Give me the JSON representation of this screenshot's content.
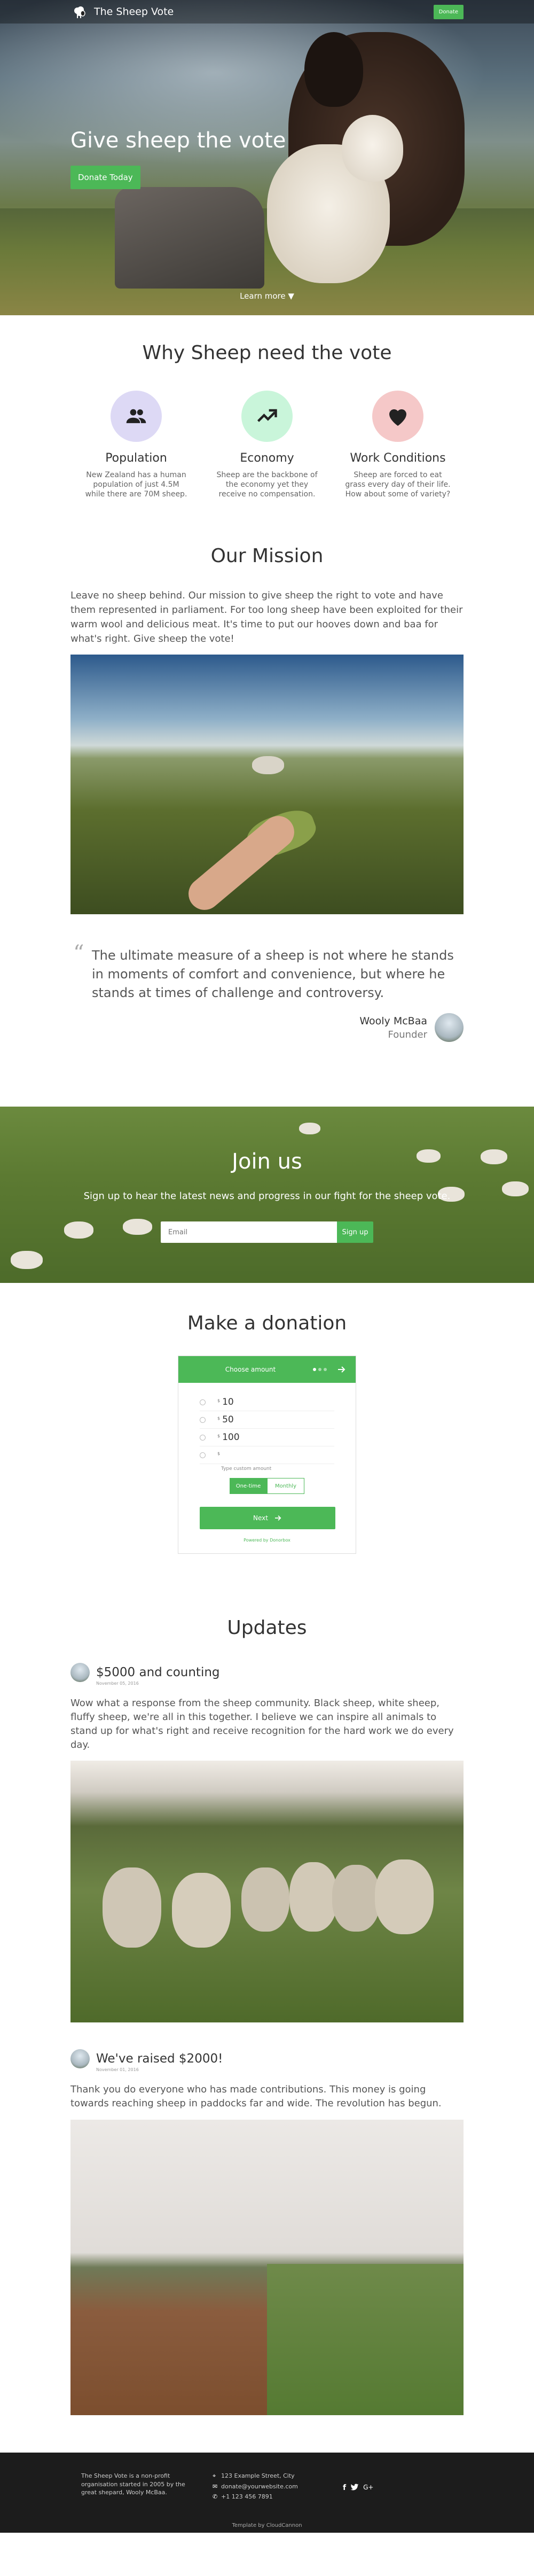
{
  "nav": {
    "brand": "The Sheep Vote",
    "donate_label": "Donate"
  },
  "hero": {
    "title": "Give sheep the vote",
    "cta_label": "Donate Today",
    "more_label": "Learn more ▼"
  },
  "why": {
    "title": "Why Sheep need the vote",
    "items": [
      {
        "icon": "group-icon",
        "name": "Population",
        "text": "New Zealand has a human population of just 4.5M while there are 70M sheep.",
        "color": "#ddd9f5"
      },
      {
        "icon": "trending-up-icon",
        "name": "Economy",
        "text": "Sheep are the backbone of the economy yet they receive no compensation.",
        "color": "#c9f5da"
      },
      {
        "icon": "heart-icon",
        "name": "Work Conditions",
        "text": "Sheep are forced to eat grass every day of their life. How about some of variety?",
        "color": "#f5c8c8"
      }
    ]
  },
  "mission": {
    "title": "Our Mission",
    "text": "Leave no sheep behind. Our mission to give sheep the right to vote and have them represented in parliament. For too long sheep have been exploited for their warm wool and delicious meat. It's time to put our hooves down and baa for what's right. Give sheep the vote!"
  },
  "quote": {
    "text": "The ultimate measure of a sheep is not where he stands in moments of comfort and convenience, but where he stands at times of challenge and controversy.",
    "author": "Wooly McBaa",
    "role": "Founder"
  },
  "join": {
    "title": "Join us",
    "subtitle": "Sign up to hear the latest news and progress in our fight for the sheep vote.",
    "email_placeholder": "Email",
    "button_label": "Sign up"
  },
  "donation": {
    "title": "Make a donation",
    "widget_title": "Choose amount",
    "currency": "$",
    "amounts": [
      "10",
      "50",
      "100"
    ],
    "custom_hint": "Type custom amount",
    "frequency": [
      "One-time",
      "Monthly"
    ],
    "next_label": "Next",
    "powered_by": "Powered by Donorbox"
  },
  "updates": {
    "title": "Updates",
    "posts": [
      {
        "title": "$5000 and counting",
        "date": "November 05, 2016",
        "text": "Wow what a response from the sheep community. Black sheep, white sheep, fluffy sheep, we're all in this together. I believe we can inspire all animals to stand up for what's right and receive recognition for the hard work we do every day."
      },
      {
        "title": "We've raised $2000!",
        "date": "November 01, 2016",
        "text": "Thank you do everyone who has made contributions. This money is going towards reaching sheep in paddocks far and wide. The revolution has begun."
      }
    ]
  },
  "footer": {
    "about": "The Sheep Vote is a non-profit organisation started in 2005 by the great shepard, Wooly McBaa.",
    "address": "123 Example Street, City",
    "email": "donate@yourwebsite.com",
    "phone": "+1 123 456 7891",
    "credit": "Template by CloudCannon",
    "social": [
      "facebook-icon",
      "twitter-icon",
      "google-plus-icon"
    ]
  }
}
